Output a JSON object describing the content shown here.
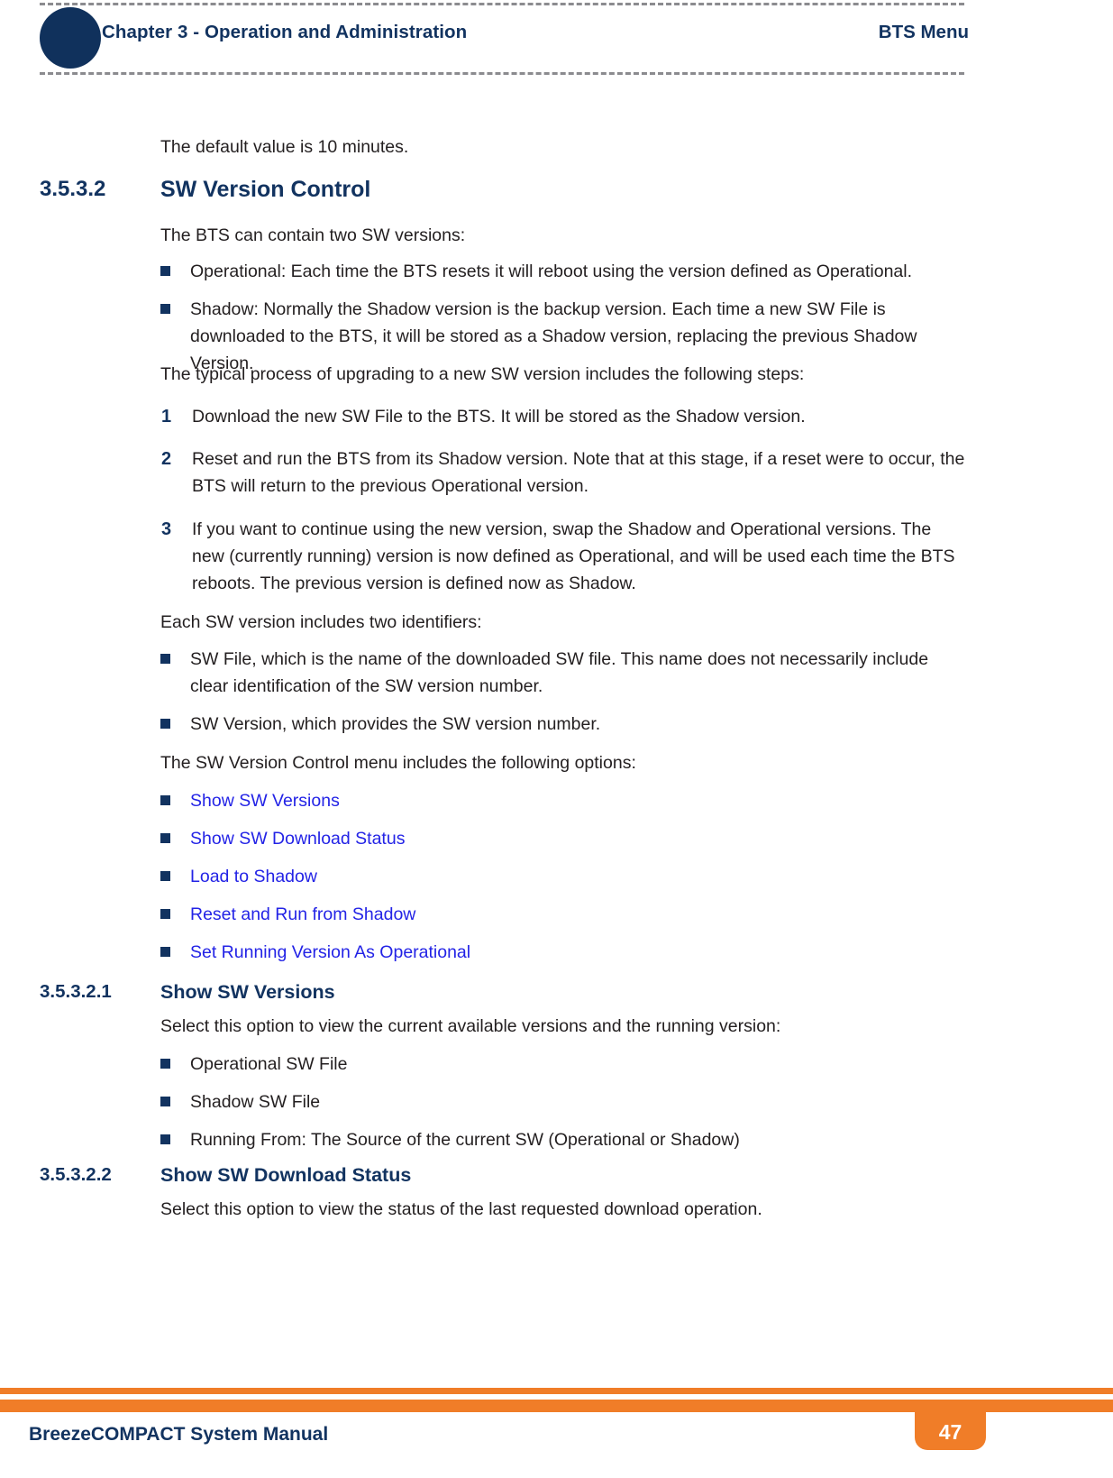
{
  "header": {
    "chapter": "Chapter 3 - Operation and Administration",
    "section": "BTS Menu"
  },
  "content": {
    "intro_para": "The default value is 10 minutes.",
    "heading_main": {
      "number": "3.5.3.2",
      "title": "SW Version Control"
    },
    "para_two_versions": "The BTS can contain two SW versions:",
    "versions_bullets": [
      "Operational: Each time the BTS resets it will reboot using the version defined as Operational.",
      "Shadow: Normally the Shadow version is the backup version. Each time a new SW File is downloaded to the BTS, it will be stored as a Shadow version, replacing the previous Shadow Version."
    ],
    "para_typical_process": "The typical process of upgrading to a new SW version includes the following steps:",
    "steps": [
      {
        "number": "1",
        "text": "Download the new SW File to the BTS. It will be stored as the Shadow version."
      },
      {
        "number": "2",
        "text": "Reset and run the BTS from its Shadow version. Note that at this stage, if a reset were to occur, the BTS will return to the previous Operational version."
      },
      {
        "number": "3",
        "text": "If you want to continue using the new version, swap the Shadow and Operational versions. The new (currently running) version is now defined as Operational, and will be used each time the BTS reboots. The previous version is defined now as Shadow."
      }
    ],
    "para_identifiers": "Each SW version includes two identifiers:",
    "identifier_bullets": [
      "SW File, which is the name of the downloaded SW file. This name does not necessarily include clear identification of the SW version number.",
      "SW Version, which provides the SW version number."
    ],
    "para_menu_options": "The SW Version Control menu includes the following options:",
    "menu_links": [
      "Show SW Versions",
      "Show SW Download Status",
      "Load to Shadow",
      "Reset and Run from Shadow",
      "Set Running Version As Operational"
    ],
    "heading_show_versions": {
      "number": "3.5.3.2.1",
      "title": "Show SW Versions"
    },
    "para_select_view": "Select this option to view the current available versions and the running version:",
    "show_versions_bullets": [
      "Operational SW File",
      "Shadow SW File",
      "Running From: The Source of the current SW (Operational or Shadow)"
    ],
    "heading_download_status": {
      "number": "3.5.3.2.2",
      "title": "Show SW Download Status"
    },
    "para_download_status": "Select this option to view the status of the last requested download operation."
  },
  "footer": {
    "title": "BreezeCOMPACT System Manual",
    "page_number": "47"
  },
  "colors": {
    "navy": "#123360",
    "orange": "#f07d28",
    "link_blue": "#2323e6",
    "body_text": "#231f20"
  }
}
